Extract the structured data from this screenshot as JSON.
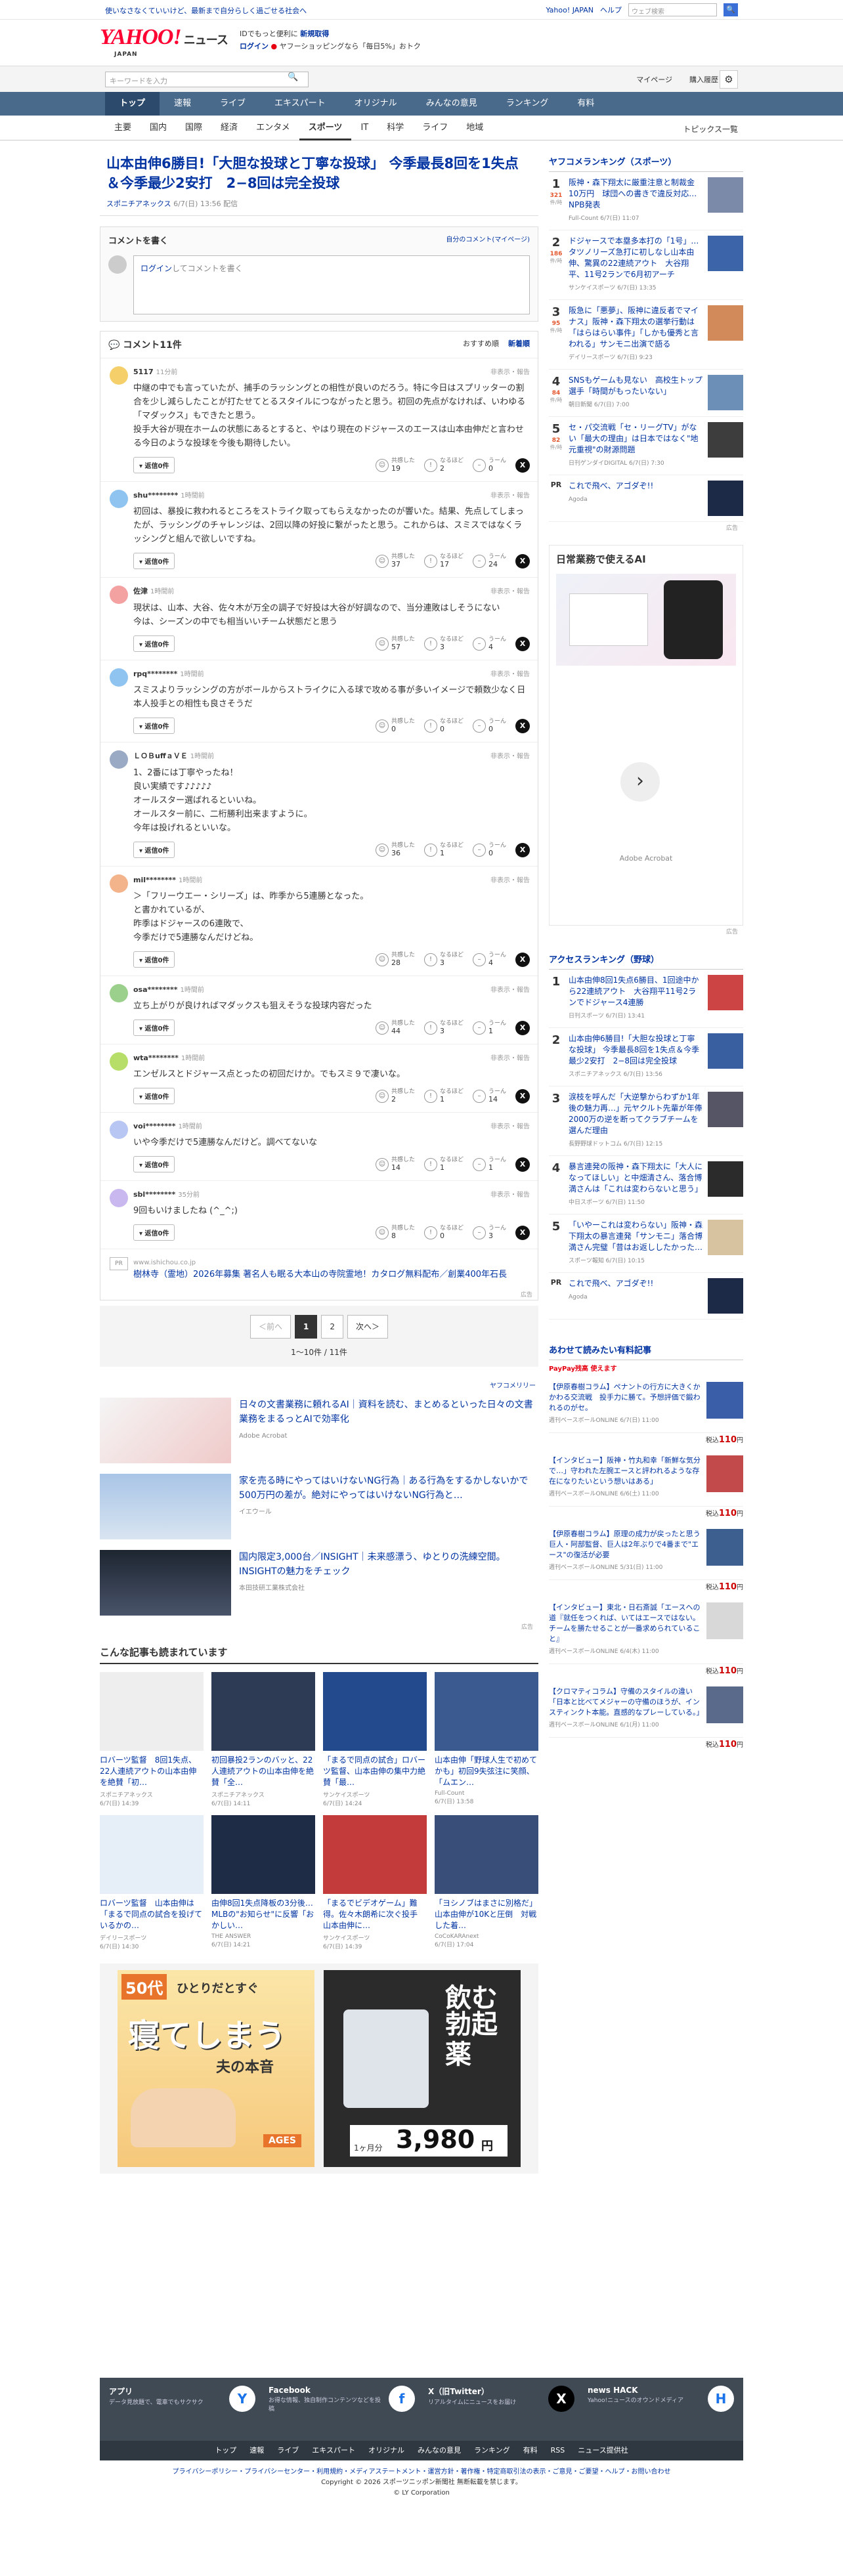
{
  "topbar": {
    "notice": "使いなさなくていいけど、最新まで自分らしく過ごせる社会へ",
    "yahoo_link": "Yahoo! JAPAN",
    "help": "ヘルプ",
    "search_placeholder": "ウェブ検索",
    "search_btn": "🔍"
  },
  "header": {
    "logo": "YAHOO!",
    "logo_sub": "ニュース",
    "logo_jp": "JAPAN",
    "promo_line1_a": "IDでもっと便利に",
    "promo_line1_b": "新規取得",
    "promo_line2_a": "ログイン",
    "promo_line2_b": "ヤフーショッピングなら「毎日5%」おトク"
  },
  "userrow": {
    "placeholder": "キーワードを入力",
    "mypage": "マイページ",
    "history": "購入履歴"
  },
  "gnav": [
    "トップ",
    "速報",
    "ライブ",
    "エキスパート",
    "オリジナル",
    "みんなの意見",
    "ランキング",
    "有料"
  ],
  "gnav_active": 0,
  "snav": [
    "主要",
    "国内",
    "国際",
    "経済",
    "エンタメ",
    "スポーツ",
    "IT",
    "科学",
    "ライフ",
    "地域"
  ],
  "snav_active": 5,
  "topics": "トピックス一覧",
  "article": {
    "title": "山本由伸6勝目!「大胆な投球と丁寧な投球」 今季最長8回を1失点＆今季最少2安打　2−8回は完全投球",
    "source": "スポニチアネックス",
    "date": "6/7(日) 13:56 配信"
  },
  "comment_write": {
    "title": "コメントを書く",
    "my": "自分のコメント(マイページ)",
    "prompt_link": "ログイン",
    "prompt": "してコメントを書く"
  },
  "comments_header": {
    "title": "コメント11件",
    "sort_a": "おすすめ順",
    "sort_b": "新着順"
  },
  "comments": [
    {
      "user": "5117",
      "time": "11分前",
      "color": "#f5d06a",
      "text": "中継の中でも言っていたが、捕手のラッシングとの相性が良いのだろう。特に今日はスプリッターの割合を少し減らしたことが打たせてとるスタイルにつながったと思う。初回の先点がなければ、いわゆる「マダックス」もできたと思う。\n投手大谷が現在ホームの状態にあるとすると、やはり現在のドジャースのエースは山本由伸だと言わせる今日のような投球を今後も期待したい。",
      "agree": "19",
      "know": "2",
      "hmm": "0",
      "replies": "返信0件"
    },
    {
      "user": "shu********",
      "time": "1時間前",
      "color": "#8fc4f0",
      "text": "初回は、暴投に救われるところをストライク取ってもらえなかったのが響いた。結果、先点してしまったが、ラッシングのチャレンジは、2回以降の好投に繋がったと思う。これからは、スミスではなくラッシングと組んで欲しいですね。",
      "agree": "37",
      "know": "17",
      "hmm": "24",
      "replies": "返信0件"
    },
    {
      "user": "佐津",
      "time": "1時間前",
      "color": "#f3a1a1",
      "text": "現状は、山本、大谷、佐々木が万全の調子で好投は大谷が好調なので、当分連敗はしそうにない\n今は、シーズンの中でも相当いいチーム状態だと思う",
      "agree": "57",
      "know": "3",
      "hmm": "4",
      "replies": "返信0件"
    },
    {
      "user": "rpq********",
      "time": "1時間前",
      "color": "#8fc4f0",
      "text": "スミスよりラッシングの方がボールからストライクに入る球で攻める事が多いイメージで頼数少なく日本人投手との相性も良さそうだ",
      "agree": "0",
      "know": "0",
      "hmm": "0",
      "replies": "返信0件"
    },
    {
      "user": "ＬＯＢuffａＶＥ",
      "time": "1時間前",
      "color": "#9aa9c4",
      "text": "1、2番には丁寧やったね！\n良い実績です♪♪♪♪♪\nオールスター選ばれるといいね。\nオールスター前に、二桁勝利出来ますように。\n今年は投げれるといいな。",
      "agree": "36",
      "know": "1",
      "hmm": "0",
      "replies": "返信0件"
    },
    {
      "user": "mil********",
      "time": "1時間前",
      "color": "#f3b48c",
      "text": "＞「フリーウエー・シリーズ」は、昨季から5連勝となった。\nと書かれているが、\n昨季はドジャースの6連敗で、\n今季だけで5連勝なんだけどね。",
      "agree": "28",
      "know": "3",
      "hmm": "4",
      "replies": "返信0件"
    },
    {
      "user": "osa********",
      "time": "1時間前",
      "color": "#9bd08c",
      "text": "立ち上がりが良ければマダックスも狙えそうな投球内容だった",
      "agree": "44",
      "know": "3",
      "hmm": "1",
      "replies": "返信0件"
    },
    {
      "user": "wta********",
      "time": "1時間前",
      "color": "#b7de68",
      "text": "エンゼルスとドジャース点とったの初回だけか。でもスミ９で凄いな。",
      "agree": "2",
      "know": "1",
      "hmm": "14",
      "replies": "返信0件"
    },
    {
      "user": "voi********",
      "time": "1時間前",
      "color": "#b7c6f2",
      "text": "いや今季だけで5連勝なんだけど。調べてないな",
      "agree": "14",
      "know": "1",
      "hmm": "1",
      "replies": "返信0件"
    },
    {
      "user": "sbl********",
      "time": "35分前",
      "color": "#c9b8f0",
      "text": "9回もいけましたね (^_^;)",
      "agree": "8",
      "know": "0",
      "hmm": "3",
      "replies": "返信0件"
    }
  ],
  "report": "非表示・報告",
  "vote_labels": {
    "agree": "共感した",
    "know": "なるほど",
    "hmm": "うーん"
  },
  "pr_comment": {
    "badge": "PR",
    "url": "www.ishichou.co.jp",
    "title": "樹林寺（霊地）2026年募集 著名人も眠る大本山の寺院霊地！カタログ無料配布／創業400年石長"
  },
  "ad_label": "広告",
  "pager": {
    "prev": "＜前へ",
    "p1": "1",
    "p2": "2",
    "next": "次へ＞",
    "info": "1〜10件 / 11件"
  },
  "sponsored": {
    "label": "ヤフコメリリー",
    "items": [
      {
        "title": "日々の文書業務に頼れるAI｜資料を読む、まとめるといった日々の文書業務をまるっとAIで効率化",
        "by": "Adobe Acrobat"
      },
      {
        "title": "家を売る時にやってはいけないNG行為｜ある行為をするかしないかで500万円の差が。絶対にやってはいけないNG行為と…",
        "by": "イエウール"
      },
      {
        "title": "国内限定3,000台／INSIGHT｜未来感漂う、ゆとりの洗練空間。INSIGHTの魅力をチェック",
        "by": "本田技研工業株式会社"
      }
    ]
  },
  "also_read": {
    "title": "こんな記事も読まれています",
    "items": [
      {
        "title": "ロバーツ監督　8回1失点、22人連続アウトの山本由伸を絶賛「初…",
        "by": "スポニチアネックス",
        "date": "6/7(日) 14:39"
      },
      {
        "title": "初回暴投2ランのバッと、22人連続アウトの山本由伸を絶賛「全…",
        "by": "スポニチアネックス",
        "date": "6/7(日) 14:11"
      },
      {
        "title": "「まるで同点の試合」ロバーツ監督、山本由伸の集中力絶賛「最…",
        "by": "サンケイスポーツ",
        "date": "6/7(日) 14:24"
      },
      {
        "title": "山本由伸「野球人生で初めてかも」初回9失弦注に笑顔、「ムエン…",
        "by": "Full-Count",
        "date": "6/7(日) 13:58"
      },
      {
        "title": "ロバーツ監督　山本由伸は「まるで同点の試合を投げているかの…",
        "by": "デイリースポーツ",
        "date": "6/7(日) 14:30"
      },
      {
        "title": "由伸8回1失点降板の3分後…MLBの\"お知らせ\"に反響「おかしい…",
        "by": "THE ANSWER",
        "date": "6/7(日) 14:21"
      },
      {
        "title": "「まるでビデオゲーム」難得。佐々木朗希に次ぐ投手　山本由伸に…",
        "by": "サンケイスポーツ",
        "date": "6/7(日) 14:39"
      },
      {
        "title": "「ヨシノブはまさに別格だ」山本由伸が10Kと圧倒　対戦した着…",
        "by": "CoCoKARAnext",
        "date": "6/7(日) 17:04"
      }
    ]
  },
  "ads_bottom": {
    "a1_line1": "50代",
    "a1_line2": "ひとりだとすぐ",
    "a1_line3": "寝てしまう",
    "a1_line4": "夫の本音",
    "a1_tag": "AGES",
    "a2_line1": "飲む",
    "a2_line2": "勃起薬",
    "a2_price": "3,980",
    "a2_unit": "円",
    "a2_month": "1ヶ月分"
  },
  "side": {
    "ranking_title": "ヤフコメランキング（スポーツ）",
    "ranking": [
      {
        "n": "1",
        "cnt": "321",
        "unit": "件/時",
        "title": "阪神・森下翔太に厳重注意と制裁金10万円　球団への書きで違反対応…NPB発表",
        "by": "Full-Count 6/7(日) 11:07"
      },
      {
        "n": "2",
        "cnt": "186",
        "unit": "件/時",
        "title": "ドジャースで本塁多本打の「1号」…タツノリーズ急打に初しなし山本由伸、驚異の22連続アウト　大谷翔平、11号2ランで6月初アーチ",
        "by": "サンケイスポーツ 6/7(日) 13:35"
      },
      {
        "n": "3",
        "cnt": "95",
        "unit": "件/時",
        "title": "阪急に「悪夢」、阪神に違反者でマイナス」阪神・森下翔太の選挙行動は「はらはらい事件」「しかも優秀と言われる」サンモニ出演で語る",
        "by": "デイリースポーツ 6/7(日) 9:23"
      },
      {
        "n": "4",
        "cnt": "84",
        "unit": "件/時",
        "title": "SNSもゲームも見ない　高校生トップ選手「時間がもったいない」",
        "by": "朝日新聞 6/7(日) 7:00"
      },
      {
        "n": "5",
        "cnt": "82",
        "unit": "件/時",
        "title": "セ・パ交流戦「セ・リーグTV」がない「最大の理由」は日本ではなく\"地元重視\"の財源問題",
        "by": "日刊ゲンダイDIGITAL 6/7(日) 7:30"
      }
    ],
    "ranking_pr": {
      "n": "PR",
      "title": "これで飛べ、アゴダぞ!!",
      "by": "Agoda"
    },
    "ai_ad_title": "日常業務で使えるAI",
    "ai_ad_by": "Adobe Acrobat",
    "access_title": "アクセスランキング（野球）",
    "access": [
      {
        "n": "1",
        "title": "山本由伸8回1失点6勝目、1回途中から22連続アウト　大谷翔平11号2ランでドジャース4連勝",
        "by": "日刊スポーツ 6/7(日) 13:41"
      },
      {
        "n": "2",
        "title": "山本由伸6勝目!「大胆な投球と丁寧な投球」 今季最長8回を1失点＆今季最少2安打　2−8回は完全投球",
        "by": "スポニチアネックス 6/7(日) 13:56"
      },
      {
        "n": "3",
        "title": "涙枝を呼んだ「大逆撃からわずか1年後の魅力再…」元ヤクルト先輩が年俸2000万の逆を断ってクラブチームを選んだ理由",
        "by": "長野野球ドットコム 6/7(日) 12:15"
      },
      {
        "n": "4",
        "title": "暴言連発の阪神・森下翔太に「大人になってほしい」と中畑清さん、落合博満さんは「これは変わらないと思う」",
        "by": "中日スポーツ 6/7(日) 11:50"
      },
      {
        "n": "5",
        "title": "「いやーこれは変わらない」阪神・森下翔太の暴言連発「サンモニ」落合博満さん完璧「昔はお返ししたかった…",
        "by": "スポーツ報知 6/7(日) 10:15"
      }
    ],
    "access_pr": {
      "n": "PR",
      "title": "これで飛べ、アゴダぞ!!",
      "by": "Agoda"
    },
    "shop_title": "あわせて読みたい有料記事",
    "shop_sub": "PayPay残高 使えます",
    "shop": [
      {
        "title": "【伊原春樹コラム】ペナントの行方に大きくかかわる交流戦　投手力に勝て。予想評価で鍛われるのがセ。",
        "by": "週刊ベースボールONLINE 6/7(日) 11:00",
        "price": "110"
      },
      {
        "title": "【インタビュー】阪神・竹丸和幸「新鮮な気分で…」守われた左腕エースと評われるような存在になりたいという想いはある」",
        "by": "週刊ベースボールONLINE 6/6(土) 11:00",
        "price": "110"
      },
      {
        "title": "【伊原春樹コラム】原理の成力が戻ったと思う巨人・阿部監督、巨人は2年ぶりで4番まで\"エース\"の復活が必要",
        "by": "週刊ベースボールONLINE 5/31(日) 11:00",
        "price": "110"
      },
      {
        "title": "【インタビュー】東北・日石斎誠「エースへの道『就任をつくれば、いてはエースではない。チームを勝たせることが一番求められていること』",
        "by": "週刊ベースボールONLINE 6/4(木) 11:00",
        "price": "110"
      },
      {
        "title": "【クロマティコラム】守備のスタイルの違い「日本と比べてメジャーの守備のほうが、インスティンクト本能。直感的なプレーしている。」",
        "by": "週刊ベースボールONLINE 6/1(月) 11:00",
        "price": "110"
      }
    ],
    "price_prefix": "税込",
    "price_suffix": "円"
  },
  "footer": {
    "cols": [
      {
        "t": "アプリ",
        "d": "データ見放題で、電車でもサクサク",
        "ic": "Y"
      },
      {
        "t": "Facebook",
        "d": "お得な情報、独自制作コンテンツなどを投稿",
        "ic": "f"
      },
      {
        "t": "X（旧Twitter）",
        "d": "リアルタイムにニュースをお届け",
        "ic": "X"
      },
      {
        "t": "news HACK",
        "d": "Yahoo!ニュースのオウンドメディア",
        "ic": "H"
      }
    ],
    "nav": [
      "トップ",
      "速報",
      "ライブ",
      "エキスパート",
      "オリジナル",
      "みんなの意見",
      "ランキング",
      "有料",
      "RSS",
      "ニュース提供社"
    ],
    "legal1": "プライバシーポリシー・プライバシーセンター・利用規約・メディアステートメント・運営方針・著作権・特定商取引法の表示・ご意見・ご要望・ヘルプ・お問い合わせ",
    "legal2": "Copyright © 2026 スポーツニッポン新聞社 無断転載を禁じます。",
    "legal3": "© LY Corporation"
  }
}
